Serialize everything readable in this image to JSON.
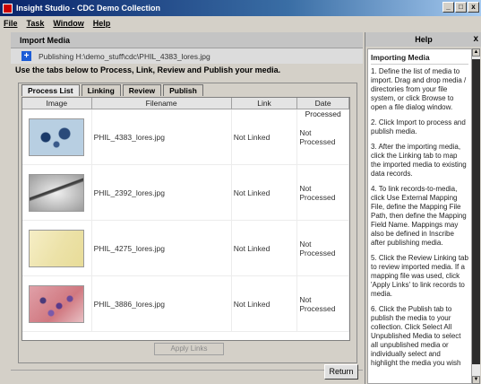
{
  "window": {
    "title": "Insight Studio - CDC Demo Collection",
    "controls": [
      "_",
      "□",
      "x"
    ]
  },
  "menu": [
    "File",
    "Task",
    "Window",
    "Help"
  ],
  "panel": {
    "title": "Import Media",
    "publishing": "Publishing H:\\demo_stuff\\cdc\\PHIL_4383_lores.jpg",
    "instructions": "Use the tabs below to Process, Link, Review and Publish your media."
  },
  "tabs": [
    "Process List",
    "Linking",
    "Review",
    "Publish"
  ],
  "table": {
    "columns": [
      "Image",
      "Filename",
      "Link",
      "Date Processed"
    ],
    "rows": [
      {
        "filename": "PHIL_4383_lores.jpg",
        "link": "Not Linked",
        "date": "Not Processed",
        "thumb": "blue-specimen"
      },
      {
        "filename": "PHIL_2392_lores.jpg",
        "link": "Not Linked",
        "date": "Not Processed",
        "thumb": "gray-filament"
      },
      {
        "filename": "PHIL_4275_lores.jpg",
        "link": "Not Linked",
        "date": "Not Processed",
        "thumb": "yellow-slide"
      },
      {
        "filename": "PHIL_3886_lores.jpg",
        "link": "Not Linked",
        "date": "Not Processed",
        "thumb": "pink-cells"
      }
    ]
  },
  "buttons": {
    "apply_links": "Apply Links",
    "return": "Return"
  },
  "help": {
    "title": "Help",
    "close": "x",
    "heading": "Importing Media",
    "paragraphs": [
      "1. Define the list of media to import. Drag and drop media / directories from your file system, or click Browse to open a file dialog window.",
      "2. Click Import to process and publish media.",
      "3. After the importing media, click the Linking tab to map the imported media to existing data records.",
      "4. To link records-to-media, click Use External Mapping File, define the Mapping File Path, then define the Mapping Field Name. Mappings may also be defined in Inscribe after publishing media.",
      "5. Click the Review Linking tab to review imported media. If a mapping file was used, click 'Apply Links' to link records to media.",
      "6. Click the Publish tab to publish the media to your collection. Click Select All Unpublished Media to select all unpublished media or individually select and highlight the media you wish"
    ]
  },
  "colors": {
    "titlebar_start": "#0a246a",
    "titlebar_end": "#a6caf0",
    "accent_icon": "#1c5cd6",
    "window_bg": "#d4d0c8"
  }
}
